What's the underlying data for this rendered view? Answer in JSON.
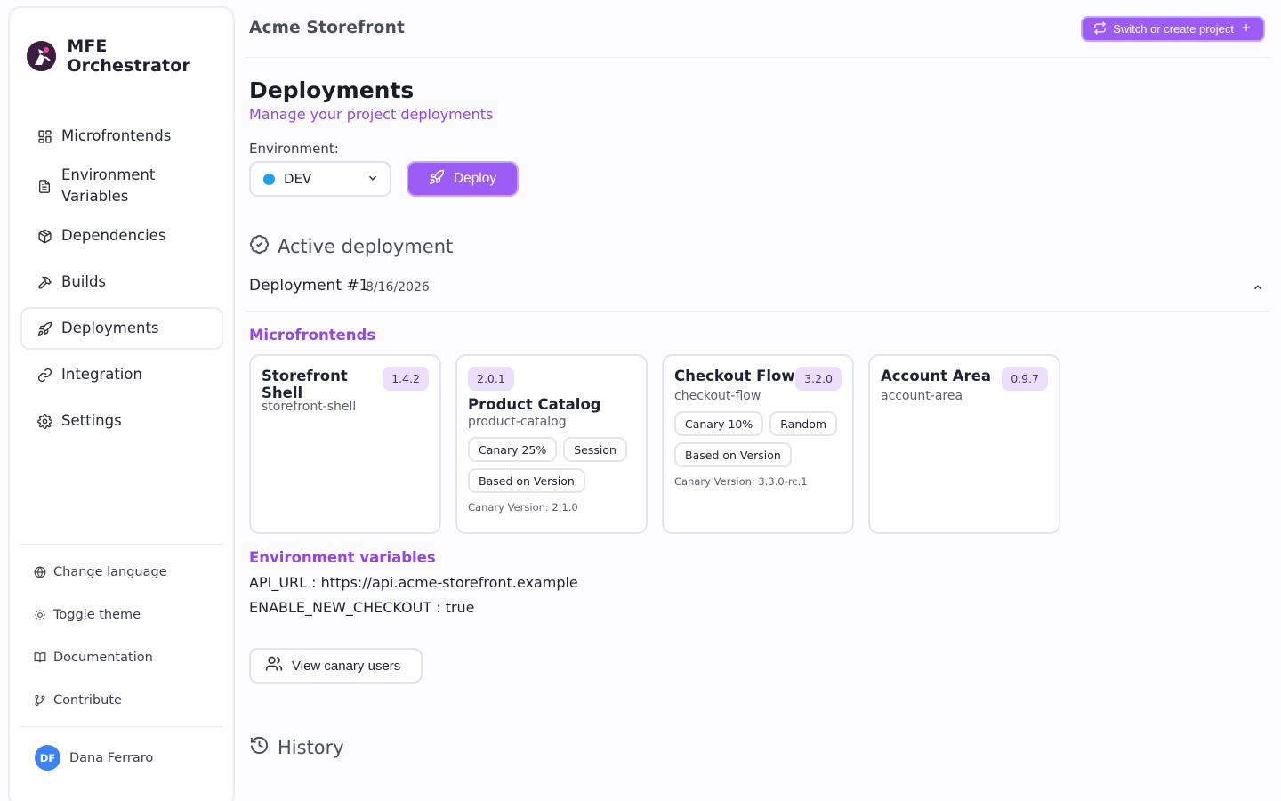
{
  "app": {
    "title": "MFE Orchestrator"
  },
  "sidebar": {
    "items": [
      {
        "label": "Microfrontends",
        "icon": "grid-icon"
      },
      {
        "label": "Environment Variables",
        "icon": "file-text-icon"
      },
      {
        "label": "Dependencies",
        "icon": "package-icon"
      },
      {
        "label": "Builds",
        "icon": "hammer-icon"
      },
      {
        "label": "Deployments",
        "icon": "rocket-icon",
        "active": true
      },
      {
        "label": "Integration",
        "icon": "link-icon"
      },
      {
        "label": "Settings",
        "icon": "gear-icon"
      }
    ],
    "utilities": [
      {
        "label": "Change language",
        "icon": "globe-icon"
      },
      {
        "label": "Toggle theme",
        "icon": "sun-icon"
      },
      {
        "label": "Documentation",
        "icon": "book-icon"
      },
      {
        "label": "Contribute",
        "icon": "git-branch-icon"
      }
    ],
    "user": {
      "initials": "DF",
      "name": "Dana Ferraro"
    }
  },
  "header": {
    "project": "Acme Storefront",
    "switch_label": "Switch or create project"
  },
  "page": {
    "title": "Deployments",
    "subtitle": "Manage your project deployments",
    "env_label": "Environment:",
    "env_value": "DEV",
    "deploy_label": "Deploy"
  },
  "active": {
    "heading": "Active deployment",
    "deployment_name": "Deployment #1",
    "deployment_date": "8/16/2026",
    "mfe_heading": "Microfrontends",
    "cards": [
      {
        "name": "Storefront Shell",
        "slug": "storefront-shell",
        "version": "1.4.2"
      },
      {
        "name": "Product Catalog",
        "slug": "product-catalog",
        "version": "2.0.1",
        "tag1": "Canary 25%",
        "tag2": "Session",
        "tag3": "Based on Version",
        "canary": "Canary Version: 2.1.0"
      },
      {
        "name": "Checkout Flow",
        "slug": "checkout-flow",
        "version": "3.2.0",
        "tag1": "Canary 10%",
        "tag2": "Random",
        "tag3": "Based on Version",
        "canary": "Canary Version: 3.3.0-rc.1"
      },
      {
        "name": "Account Area",
        "slug": "account-area",
        "version": "0.9.7"
      }
    ],
    "env_heading": "Environment variables",
    "env_vars": [
      {
        "key": "API_URL",
        "value": "https://api.acme-storefront.example"
      },
      {
        "key": "ENABLE_NEW_CHECKOUT",
        "value": "true"
      }
    ],
    "canary_users_label": "View canary users"
  },
  "history": {
    "heading": "History"
  },
  "colors": {
    "accent": "#9d5cf5",
    "accent_text": "#9346e8",
    "env_dot": "#1ea1f2",
    "avatar": "#3b82f6"
  }
}
